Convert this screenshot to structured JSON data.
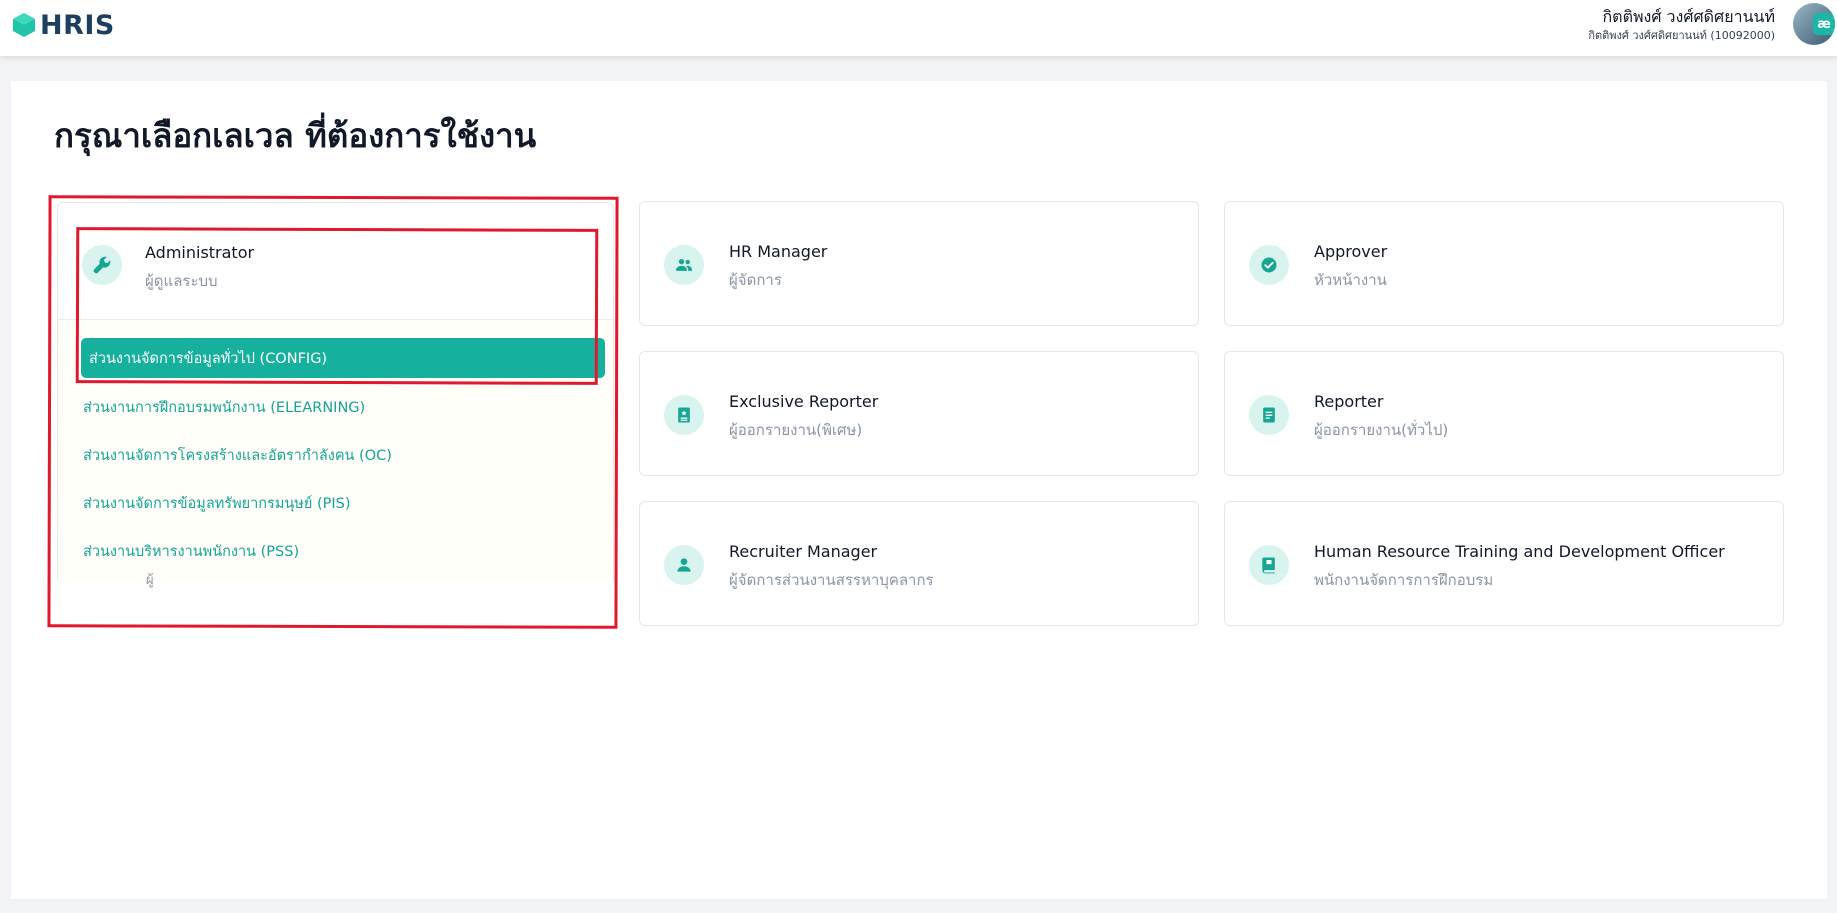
{
  "header": {
    "logo_text": "HRIS",
    "user_name": "กิตติพงศ์ วงศ์ศดิศยานนท์",
    "user_sub": "กิตติพงศ์ วงศ์ศดิศยานนท์ (10092000)",
    "avatar_badge": "æ"
  },
  "page": {
    "title": "กรุณาเลือกเลเวล ที่ต้องการใช้งาน"
  },
  "admin": {
    "title": "Administrator",
    "subtitle": "ผู้ดูแลระบบ",
    "icon": "wrench-icon",
    "menu": [
      "ส่วนงานจัดการข้อมูลทั่วไป (CONFIG)",
      "ส่วนงานการฝึกอบรมพนักงาน (ELEARNING)",
      "ส่วนงานจัดการโครงสร้างและอัตรากำลังคน (OC)",
      "ส่วนงานจัดการข้อมูลทรัพยากรมนุษย์ (PIS)",
      "ส่วนงานบริหารงานพนักงาน (PSS)"
    ],
    "peek_text": "ผู้"
  },
  "roles": [
    {
      "title": "HR Manager",
      "subtitle": "ผู้จัดการ",
      "icon": "users-icon"
    },
    {
      "title": "Approver",
      "subtitle": "หัวหน้างาน",
      "icon": "check-circle-icon"
    },
    {
      "title": "Exclusive Reporter",
      "subtitle": "ผู้ออกรายงาน(พิเศษ)",
      "icon": "star-badge-icon"
    },
    {
      "title": "Reporter",
      "subtitle": "ผู้ออกรายงาน(ทั่วไป)",
      "icon": "document-icon"
    },
    {
      "title": "Recruiter Manager",
      "subtitle": "ผู้จัดการส่วนงานสรรหาบุคลากร",
      "icon": "user-icon"
    },
    {
      "title": "Human Resource Training and Development Officer",
      "subtitle": "พนักงานจัดการการฝึกอบรม",
      "icon": "book-icon"
    }
  ],
  "colors": {
    "accent": "#17b09d",
    "icon_bg": "#d9f3ee",
    "annotation": "#e0192f"
  }
}
